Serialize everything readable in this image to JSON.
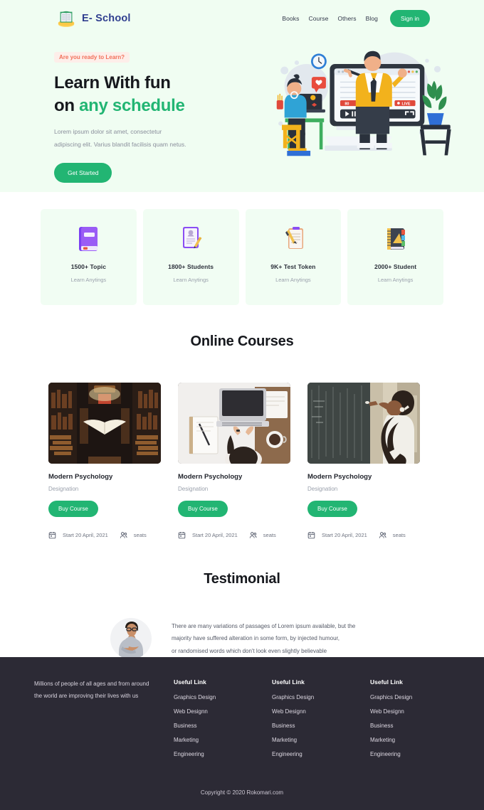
{
  "brand": {
    "name": "E- School",
    "logo_icon": "open-book-logo"
  },
  "nav": {
    "links": [
      {
        "label": "Books"
      },
      {
        "label": "Course"
      },
      {
        "label": "Others"
      },
      {
        "label": "Blog"
      }
    ],
    "signin_label": "Sign in"
  },
  "hero": {
    "eyebrow": "Are you ready to Learn?",
    "title_line1": "Learn With fun",
    "title_line2_plain": "on ",
    "title_line2_accent": "any schedule",
    "sub_line1": "Lorem ipsum dolor sit amet, consectetur",
    "sub_line2": "adipiscing elit. Varius blandit facilisis quam netus.",
    "cta_label": "Get Started",
    "art_icon": "online-classroom-illustration",
    "bg_color": "#f0fdf2",
    "accent_color": "#22b573",
    "eyebrow_color": "#f2705a"
  },
  "features": [
    {
      "icon": "purple-book-icon",
      "title": "1500+ Topic",
      "sub": "Learn Anytings"
    },
    {
      "icon": "certificate-pen-icon",
      "title": "1800+ Students",
      "sub": "Learn Anytings"
    },
    {
      "icon": "clipboard-pen-icon",
      "title": "9K+ Test Token",
      "sub": "Learn Anytings"
    },
    {
      "icon": "notebook-ruler-icon",
      "title": "2000+ Student",
      "sub": "Learn Anytings"
    }
  ],
  "courses_section": {
    "title": "Online Courses",
    "cards": [
      {
        "image": "library-open-book-photo",
        "name": "Modern Psychology",
        "role": "Designation",
        "buy_label": "Buy Course",
        "date_icon": "calendar-icon",
        "date": "Start 20 April, 2021",
        "seats_icon": "people-icon",
        "seats": "seats"
      },
      {
        "image": "laptop-desk-photo",
        "name": "Modern Psychology",
        "role": "Designation",
        "buy_label": "Buy Course",
        "date_icon": "calendar-icon",
        "date": "Start 20 April, 2021",
        "seats_icon": "people-icon",
        "seats": "seats"
      },
      {
        "image": "student-chalkboard-photo",
        "name": "Modern Psychology",
        "role": "Designation",
        "buy_label": "Buy Course",
        "date_icon": "calendar-icon",
        "date": "Start 20 April, 2021",
        "seats_icon": "people-icon",
        "seats": "seats"
      }
    ]
  },
  "testimonial_section": {
    "title": "Testimonial",
    "avatar_icon": "person-avatar-photo",
    "line1": "There are many variations of passages of Lorem ipsum available, but the",
    "line2": "majority have suffered alteration in some form, by injected humour,",
    "line3": "or randomised words which don't look even slightly believable"
  },
  "footer": {
    "about_line1": "Millions of people of all ages and from around",
    "about_line2": "the world are improving their lives with us",
    "columns": [
      {
        "heading": "Useful Link",
        "links": [
          "Graphics Design",
          "Web Designn",
          "Business",
          "Marketing",
          "Engineering"
        ]
      },
      {
        "heading": "Useful Link",
        "links": [
          "Graphics Design",
          "Web Designn",
          "Business",
          "Marketing",
          "Engineering"
        ]
      },
      {
        "heading": "Useful Link",
        "links": [
          "Graphics Design",
          "Web Designn",
          "Business",
          "Marketing",
          "Engineering"
        ]
      }
    ],
    "copyright": "Copyright © 2020 Rokomari.com",
    "bg_color": "#2c2a35"
  }
}
